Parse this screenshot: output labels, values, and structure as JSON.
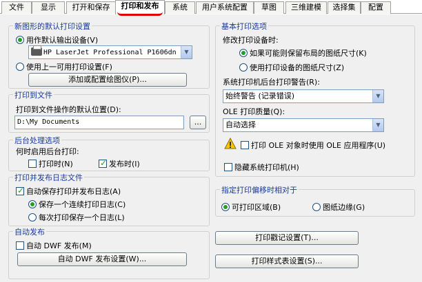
{
  "tabs": [
    "文件",
    "显示",
    "打开和保存",
    "打印和发布",
    "系统",
    "用户系统配置",
    "草图",
    "三维建模",
    "选择集",
    "配置"
  ],
  "default_output": {
    "title": "新图形的默认打印设置",
    "use_as_default": "用作默认输出设备(V)",
    "device": "HP LaserJet Professional P1606dn",
    "use_last": "使用上一可用打印设置(F)",
    "add_plotter_button": "添加或配置绘图仪(P)..."
  },
  "plot_to_file": {
    "title": "打印到文件",
    "location_label": "打印到文件操作的默认位置(D):",
    "location_value": "D:\\My Documents",
    "browse_button": "..."
  },
  "background": {
    "title": "后台处理选项",
    "enable_label": "何时启用后台打印:",
    "plotting": "打印时(N)",
    "publishing": "发布时(I)"
  },
  "log": {
    "title": "打印并发布日志文件",
    "auto_save": "自动保存打印并发布日志(A)",
    "continuous": "保存一个连续打印日志(C)",
    "per_plot": "每次打印保存一个日志(L)"
  },
  "auto_publish": {
    "title": "自动发布",
    "auto_dwf": "自动 DWF 发布(M)",
    "settings_button": "自动 DWF 发布设置(W)..."
  },
  "general": {
    "title": "基本打印选项",
    "paper_size_label": "修改打印设备时:",
    "keep_layout": "如果可能则保留布局的图纸尺寸(K)",
    "use_device": "使用打印设备的图纸尺寸(Z)",
    "spooler_label": "系统打印机后台打印警告(R):",
    "spooler_value": "始终警告 (记录错误)",
    "ole_quality_label": "OLE 打印质量(Q):",
    "ole_quality_value": "自动选择",
    "ole_app": "打印 OLE 对象时使用 OLE 应用程序(U)",
    "hide_printers": "隐藏系统打印机(H)"
  },
  "offset": {
    "title": "指定打印偏移时相对于",
    "printable_area": "可打印区域(B)",
    "paper_edge": "图纸边缘(G)"
  },
  "buttons": {
    "stamp": "打印戳记设置(T)...",
    "style_table": "打印样式表设置(S)..."
  }
}
